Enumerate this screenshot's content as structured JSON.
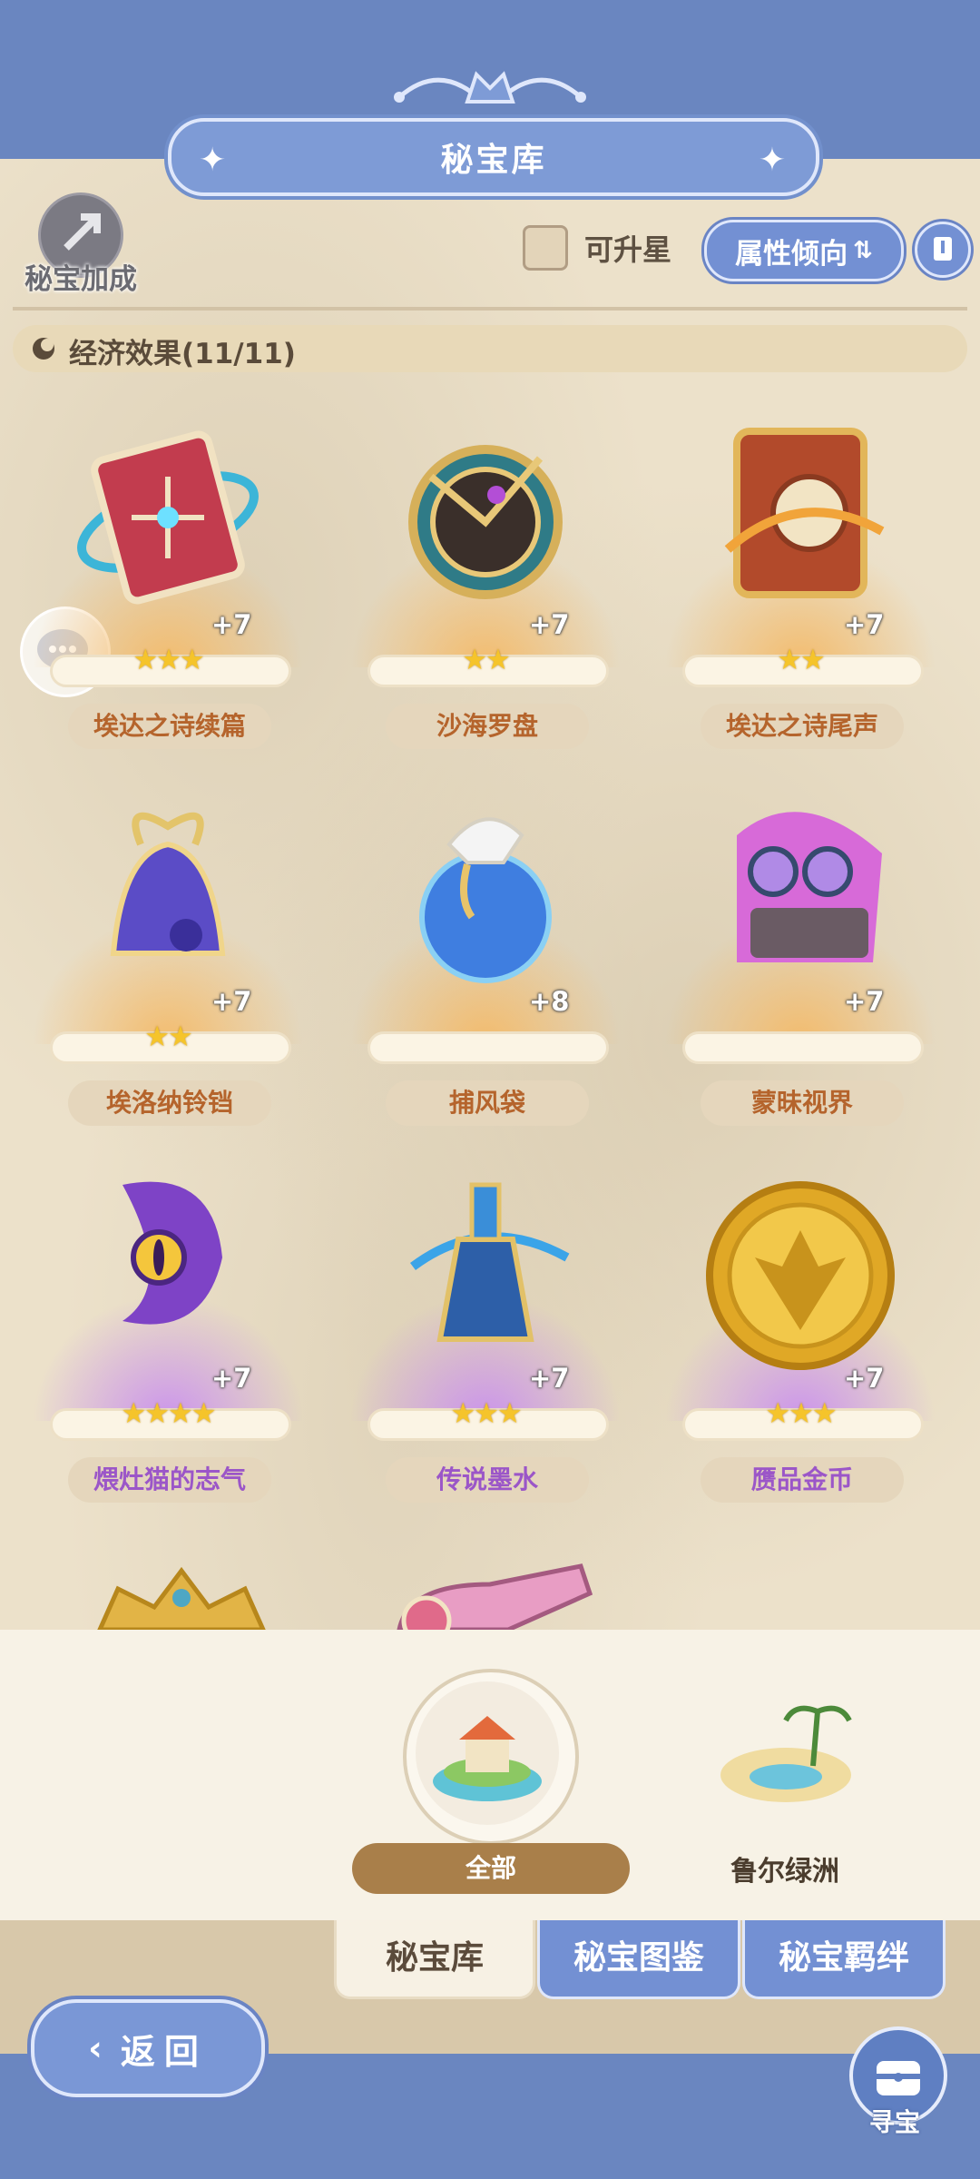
{
  "header": {
    "title": "秘宝库"
  },
  "toolbar": {
    "bonus_label": "秘宝加成",
    "upgradable_label": "可升星",
    "sort_label": "属性倾向"
  },
  "section": {
    "title": "经济效果(11/11)"
  },
  "items": [
    {
      "name": "埃达之诗续篇",
      "level": "+7",
      "stars": "★★★",
      "rarity": "orange"
    },
    {
      "name": "沙海罗盘",
      "level": "+7",
      "stars": "★★",
      "rarity": "orange"
    },
    {
      "name": "埃达之诗尾声",
      "level": "+7",
      "stars": "★★",
      "rarity": "orange"
    },
    {
      "name": "埃洛纳铃铛",
      "level": "+7",
      "stars": "★★",
      "rarity": "orange"
    },
    {
      "name": "捕风袋",
      "level": "+8",
      "stars": "",
      "rarity": "orange"
    },
    {
      "name": "蒙昧视界",
      "level": "+7",
      "stars": "",
      "rarity": "orange"
    },
    {
      "name": "煨灶猫的志气",
      "level": "+7",
      "stars": "★★★★",
      "rarity": "purple"
    },
    {
      "name": "传说墨水",
      "level": "+7",
      "stars": "★★★",
      "rarity": "purple"
    },
    {
      "name": "赝品金币",
      "level": "+7",
      "stars": "★★★",
      "rarity": "purple"
    }
  ],
  "regions": {
    "all_label": "全部",
    "oasis_label": "鲁尔绿洲"
  },
  "tabs": {
    "vault": "秘宝库",
    "codex": "秘宝图鉴",
    "bond": "秘宝羁绊"
  },
  "nav": {
    "back_label": "返回",
    "treasure_label": "寻宝"
  },
  "colors": {
    "accent_blue": "#7390d3",
    "orange_text": "#b5642c",
    "purple_text": "#9b56c8",
    "star_gold": "#f5c42b"
  },
  "icons": [
    "bonus-icon",
    "book-icon",
    "sort-icon",
    "chat-icon",
    "treasure-chest-icon",
    "back-arrow-icon",
    "economy-icon"
  ]
}
